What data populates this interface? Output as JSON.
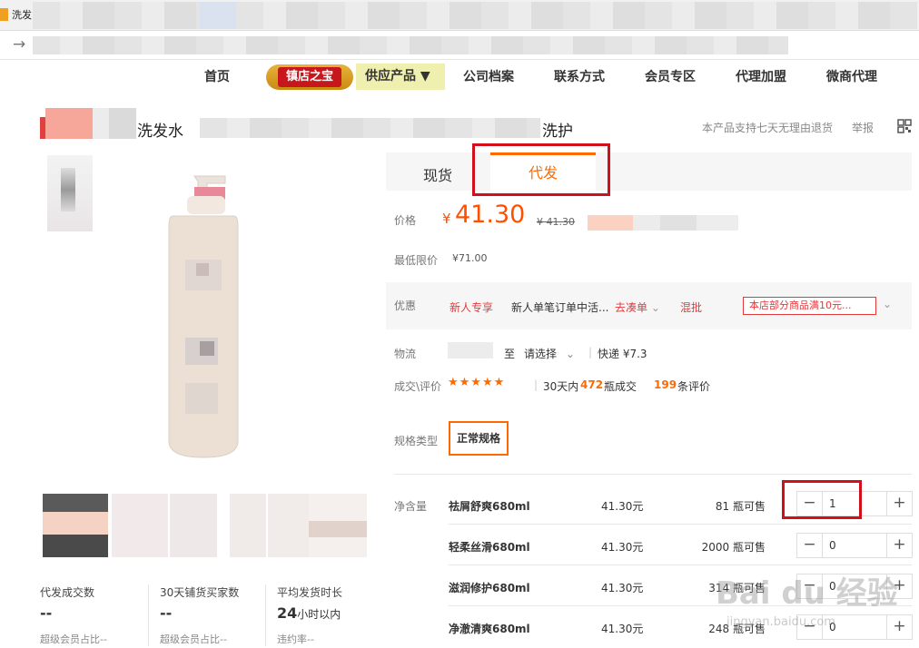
{
  "browser": {
    "tab_title": "洗发"
  },
  "nav": {
    "items": [
      "首页",
      "供应产品 ▼",
      "公司档案",
      "联系方式",
      "会员专区",
      "代理加盟",
      "微商代理"
    ],
    "shop_badge": "镇店之宝"
  },
  "product": {
    "title_part1": "洗发水",
    "title_part2": "洗护",
    "return_note": "本产品支持七天无理由退货",
    "report": "举报"
  },
  "tabs": {
    "spot": "现货",
    "dropship": "代发"
  },
  "price": {
    "label": "价格",
    "symbol": "¥",
    "value": "41.30",
    "old": "¥ 41.30",
    "min_label": "最低限价",
    "min_value": "¥71.00"
  },
  "offer": {
    "label": "优惠",
    "new_user": "新人专享",
    "desc": "新人单笔订单中活...",
    "link": "去凑单",
    "mix": "混批",
    "coupon": "本店部分商品满10元..."
  },
  "logistics": {
    "label": "物流",
    "to": "至",
    "select": "请选择",
    "express": "快递 ¥7.3"
  },
  "deals": {
    "label": "成交\\评价",
    "stars": "★★★★★",
    "period": "30天内",
    "count": "472",
    "count_unit": "瓶成交",
    "reviews": "199",
    "reviews_unit": "条评价"
  },
  "spec": {
    "type_label": "规格类型",
    "type_value": "正常规格",
    "net_label": "净含量",
    "rows": [
      {
        "name": "祛屑舒爽680ml",
        "price": "41.30元",
        "stock": "81 瓶可售",
        "qty": "1"
      },
      {
        "name": "轻柔丝滑680ml",
        "price": "41.30元",
        "stock": "2000 瓶可售",
        "qty": "0"
      },
      {
        "name": "滋润修护680ml",
        "price": "41.30元",
        "stock": "314 瓶可售",
        "qty": "0"
      },
      {
        "name": "净澈清爽680ml",
        "price": "41.30元",
        "stock": "248 瓶可售",
        "qty": "0"
      }
    ]
  },
  "stats": [
    {
      "label": "代发成交数",
      "value": "--",
      "sub": "超级会员占比--"
    },
    {
      "label": "30天铺货买家数",
      "value": "--",
      "sub": "超级会员占比--"
    },
    {
      "label": "平均发货时长",
      "value": "24",
      "value_unit": "小时以内",
      "sub": "违约率--"
    }
  ],
  "watermark": {
    "main": "Bai du 经验",
    "sub": "jingyan.baidu.com"
  },
  "colors": {
    "accent": "#ff6a00",
    "price": "#ff5000",
    "highlight_box": "#d0101b"
  }
}
